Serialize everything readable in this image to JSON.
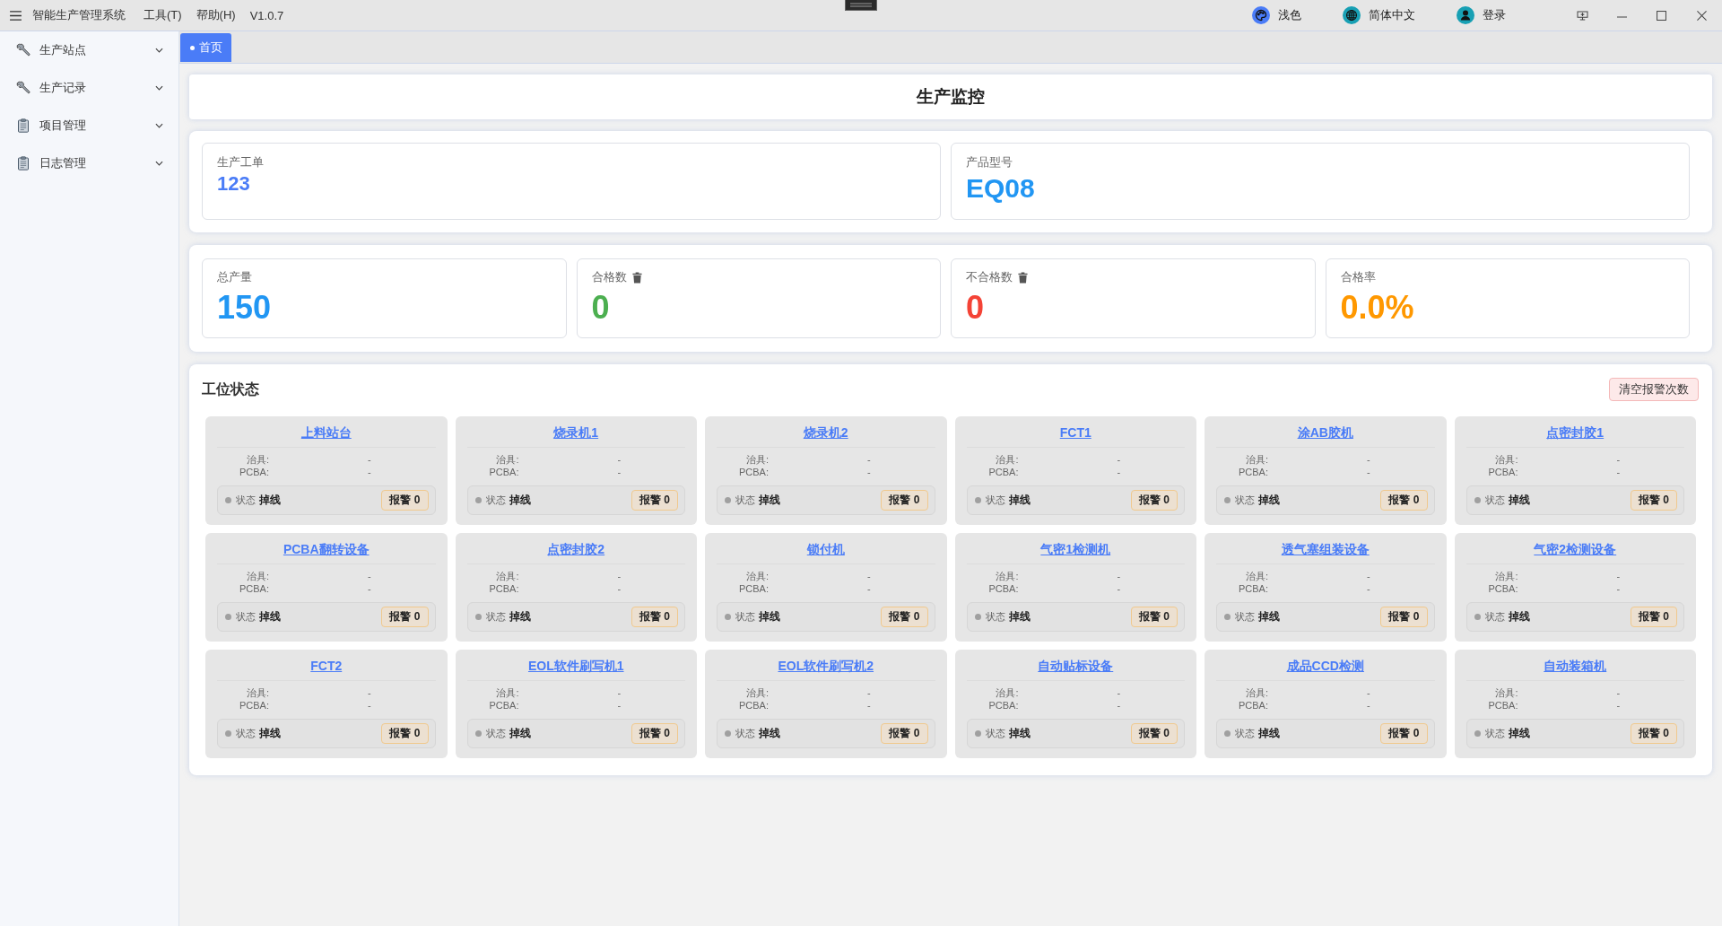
{
  "window": {
    "title": "智能生产管理系统",
    "menus": [
      "工具(T)",
      "帮助(H)"
    ],
    "version": "V1.0.7",
    "actions": [
      {
        "kind": "theme",
        "label": "浅色"
      },
      {
        "kind": "language",
        "label": "简体中文"
      },
      {
        "kind": "account",
        "label": "登录"
      }
    ]
  },
  "sidebar": {
    "items": [
      {
        "kind": "tools",
        "label": "生产站点",
        "expanded": false
      },
      {
        "kind": "tools",
        "label": "生产记录",
        "expanded": false
      },
      {
        "kind": "docs",
        "label": "项目管理",
        "expanded": false
      },
      {
        "kind": "docs",
        "label": "日志管理",
        "expanded": false
      }
    ]
  },
  "tabs": [
    {
      "label": "首页",
      "selected": true
    }
  ],
  "page_title": "生产监控",
  "order_info": [
    {
      "label": "生产工单",
      "value": "123"
    },
    {
      "label": "产品型号",
      "value": "EQ08"
    }
  ],
  "stats": [
    {
      "label": "总产量",
      "value": "150",
      "color": "#2196f3",
      "clearable": false
    },
    {
      "label": "合格数",
      "value": "0",
      "color": "#4caf50",
      "clearable": true
    },
    {
      "label": "不合格数",
      "value": "0",
      "color": "#f44336",
      "clearable": true
    },
    {
      "label": "合格率",
      "value": "0.0%",
      "color": "#ff9800",
      "clearable": false
    }
  ],
  "workstations": {
    "title": "工位状态",
    "clear_button": "清空报警次数",
    "stations": [
      {
        "name": "上料站台",
        "fields": [
          {
            "label": "治具:",
            "value": "-"
          },
          {
            "label": "PCBA:",
            "value": "-"
          }
        ],
        "status_label": "状态",
        "status": "掉线",
        "online": false,
        "alarm": "报警 0"
      },
      {
        "name": "烧录机1",
        "fields": [
          {
            "label": "治具:",
            "value": "-"
          },
          {
            "label": "PCBA:",
            "value": "-"
          }
        ],
        "status_label": "状态",
        "status": "掉线",
        "online": false,
        "alarm": "报警 0"
      },
      {
        "name": "烧录机2",
        "fields": [
          {
            "label": "治具:",
            "value": "-"
          },
          {
            "label": "PCBA:",
            "value": "-"
          }
        ],
        "status_label": "状态",
        "status": "掉线",
        "online": false,
        "alarm": "报警 0"
      },
      {
        "name": "FCT1",
        "fields": [
          {
            "label": "治具:",
            "value": "-"
          },
          {
            "label": "PCBA:",
            "value": "-"
          }
        ],
        "status_label": "状态",
        "status": "掉线",
        "online": false,
        "alarm": "报警 0"
      },
      {
        "name": "涂AB胶机",
        "fields": [
          {
            "label": "治具:",
            "value": "-"
          },
          {
            "label": "PCBA:",
            "value": "-"
          }
        ],
        "status_label": "状态",
        "status": "掉线",
        "online": false,
        "alarm": "报警 0"
      },
      {
        "name": "点密封胶1",
        "fields": [
          {
            "label": "治具:",
            "value": "-"
          },
          {
            "label": "PCBA:",
            "value": "-"
          }
        ],
        "status_label": "状态",
        "status": "掉线",
        "online": false,
        "alarm": "报警 0"
      },
      {
        "name": "PCBA翻转设备",
        "fields": [
          {
            "label": "治具:",
            "value": "-"
          },
          {
            "label": "PCBA:",
            "value": "-"
          }
        ],
        "status_label": "状态",
        "status": "掉线",
        "online": false,
        "alarm": "报警 0"
      },
      {
        "name": "点密封胶2",
        "fields": [
          {
            "label": "治具:",
            "value": "-"
          },
          {
            "label": "PCBA:",
            "value": "-"
          }
        ],
        "status_label": "状态",
        "status": "掉线",
        "online": false,
        "alarm": "报警 0"
      },
      {
        "name": "锁付机",
        "fields": [
          {
            "label": "治具:",
            "value": "-"
          },
          {
            "label": "PCBA:",
            "value": "-"
          }
        ],
        "status_label": "状态",
        "status": "掉线",
        "online": false,
        "alarm": "报警 0"
      },
      {
        "name": "气密1检测机",
        "fields": [
          {
            "label": "治具:",
            "value": "-"
          },
          {
            "label": "PCBA:",
            "value": "-"
          }
        ],
        "status_label": "状态",
        "status": "掉线",
        "online": false,
        "alarm": "报警 0"
      },
      {
        "name": "透气塞组装设备",
        "fields": [
          {
            "label": "治具:",
            "value": "-"
          },
          {
            "label": "PCBA:",
            "value": "-"
          }
        ],
        "status_label": "状态",
        "status": "掉线",
        "online": false,
        "alarm": "报警 0"
      },
      {
        "name": "气密2检测设备",
        "fields": [
          {
            "label": "治具:",
            "value": "-"
          },
          {
            "label": "PCBA:",
            "value": "-"
          }
        ],
        "status_label": "状态",
        "status": "掉线",
        "online": false,
        "alarm": "报警 0"
      },
      {
        "name": "FCT2",
        "fields": [
          {
            "label": "治具:",
            "value": "-"
          },
          {
            "label": "PCBA:",
            "value": "-"
          }
        ],
        "status_label": "状态",
        "status": "掉线",
        "online": false,
        "alarm": "报警 0"
      },
      {
        "name": "EOL软件刷写机1",
        "fields": [
          {
            "label": "治具:",
            "value": "-"
          },
          {
            "label": "PCBA:",
            "value": "-"
          }
        ],
        "status_label": "状态",
        "status": "掉线",
        "online": false,
        "alarm": "报警 0"
      },
      {
        "name": "EOL软件刷写机2",
        "fields": [
          {
            "label": "治具:",
            "value": "-"
          },
          {
            "label": "PCBA:",
            "value": "-"
          }
        ],
        "status_label": "状态",
        "status": "掉线",
        "online": false,
        "alarm": "报警 0"
      },
      {
        "name": "自动贴标设备",
        "fields": [
          {
            "label": "治具:",
            "value": "-"
          },
          {
            "label": "PCBA:",
            "value": "-"
          }
        ],
        "status_label": "状态",
        "status": "掉线",
        "online": false,
        "alarm": "报警 0"
      },
      {
        "name": "成品CCD检测",
        "fields": [
          {
            "label": "治具:",
            "value": "-"
          },
          {
            "label": "PCBA:",
            "value": "-"
          }
        ],
        "status_label": "状态",
        "status": "掉线",
        "online": false,
        "alarm": "报警 0"
      },
      {
        "name": "自动装箱机",
        "fields": [
          {
            "label": "治具:",
            "value": "-"
          },
          {
            "label": "PCBA:",
            "value": "-"
          }
        ],
        "status_label": "状态",
        "status": "掉线",
        "online": false,
        "alarm": "报警 0"
      }
    ]
  }
}
